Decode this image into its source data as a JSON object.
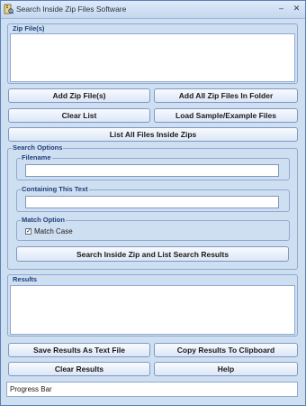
{
  "window": {
    "title": "Search Inside Zip Files Software"
  },
  "zip_files": {
    "label": "Zip File(s)"
  },
  "buttons": {
    "add_zip": "Add Zip File(s)",
    "add_all_zip": "Add All Zip Files In Folder",
    "clear_list": "Clear List",
    "load_sample": "Load Sample/Example Files",
    "list_all": "List All Files Inside Zips",
    "search": "Search Inside Zip and List Search Results",
    "save_results": "Save Results As Text File",
    "copy_results": "Copy Results To Clipboard",
    "clear_results": "Clear Results",
    "help": "Help"
  },
  "search_options": {
    "label": "Search Options",
    "filename": {
      "label": "Filename",
      "value": ""
    },
    "containing": {
      "label": "Containing This Text",
      "value": ""
    },
    "match": {
      "label": "Match Option",
      "match_case_label": "Match Case",
      "match_case_checked": true
    }
  },
  "results": {
    "label": "Results"
  },
  "progress": {
    "label": "Progress Bar"
  }
}
